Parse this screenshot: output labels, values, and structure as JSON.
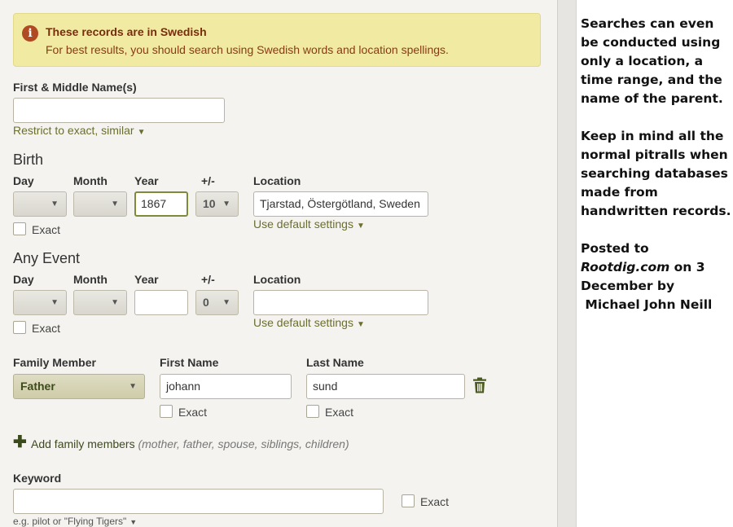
{
  "alert": {
    "icon": "info-icon",
    "title": "These records are in Swedish",
    "body": "For best results, you should search using Swedish words and location spellings."
  },
  "name": {
    "label": "First & Middle Name(s)",
    "value": "",
    "restrict_link": "Restrict to exact, similar"
  },
  "birth": {
    "heading": "Birth",
    "day_label": "Day",
    "month_label": "Month",
    "year_label": "Year",
    "range_label": "+/-",
    "location_label": "Location",
    "day_value": "",
    "month_value": "",
    "year_value": "1867",
    "range_value": "10",
    "location_value": "Tjarstad, Östergötland, Sweden",
    "exact_label": "Exact",
    "default_link": "Use default settings"
  },
  "event": {
    "heading": "Any Event",
    "day_label": "Day",
    "month_label": "Month",
    "year_label": "Year",
    "range_label": "+/-",
    "location_label": "Location",
    "day_value": "",
    "month_value": "",
    "year_value": "",
    "range_value": "0",
    "location_value": "",
    "exact_label": "Exact",
    "default_link": "Use default settings"
  },
  "family": {
    "member_label": "Family Member",
    "first_label": "First Name",
    "last_label": "Last Name",
    "member_value": "Father",
    "first_value": "johann",
    "last_value": "sund",
    "first_exact": "Exact",
    "last_exact": "Exact",
    "add_label": "Add family members",
    "add_hint": "(mother, father, spouse, siblings, children)"
  },
  "keyword": {
    "label": "Keyword",
    "value": "",
    "exact_label": "Exact",
    "example": "e.g. pilot or \"Flying Tigers\""
  },
  "note": {
    "p1": "Searches can even be conducted using only a location, a time range, and the name of the parent.",
    "p2": "Keep in mind all the normal pitralls when searching databases made from handwritten records.",
    "p3_prefix": "Posted to",
    "p3_site": "Rootdig.com",
    "p3_suffix": "on 3 December by",
    "p3_author": "Michael John Neill"
  }
}
